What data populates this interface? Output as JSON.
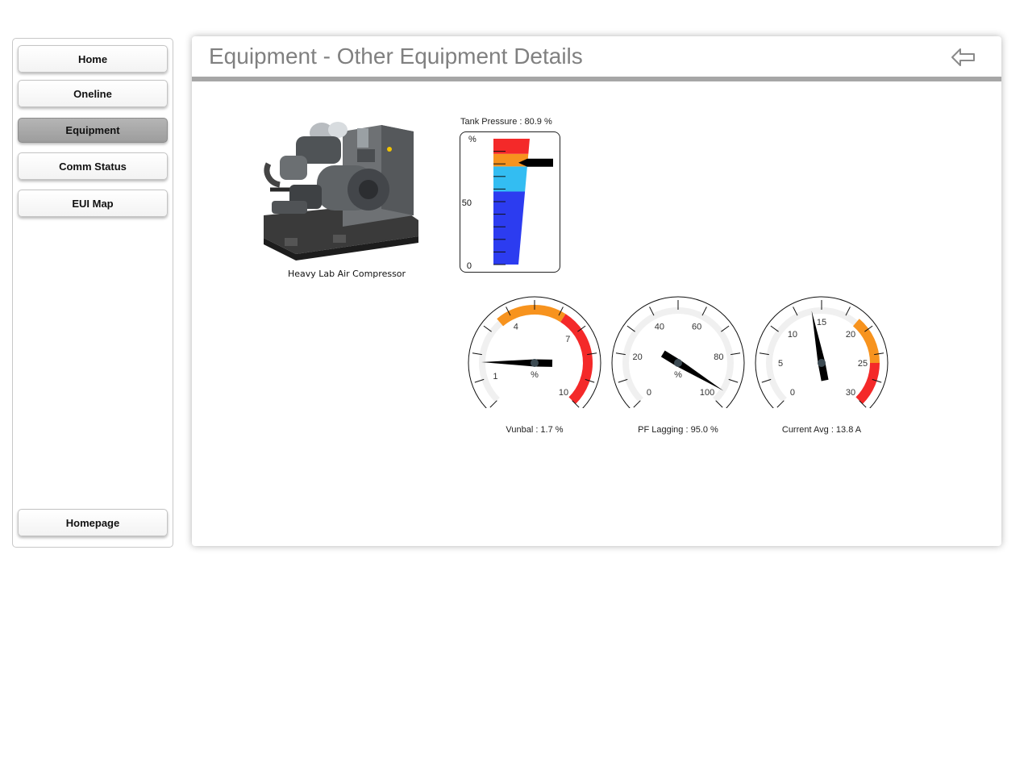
{
  "sidebar": {
    "items": [
      {
        "label": "Home"
      },
      {
        "label": "Oneline"
      },
      {
        "label": "Equipment",
        "active": true
      },
      {
        "label": "Comm Status"
      },
      {
        "label": "EUI Map"
      }
    ],
    "homepage_label": "Homepage"
  },
  "header": {
    "title": "Equipment - Other Equipment Details",
    "back_icon": "back-arrow-icon"
  },
  "equipment": {
    "caption": "Heavy Lab Air Compressor"
  },
  "colors": {
    "accent_red": "#f42929",
    "accent_orange": "#f7931e",
    "accent_cyan": "#33bdf2",
    "accent_blue": "#2c3cf0",
    "active_nav": "#a8a8a8",
    "header_rule": "#a6a6a6"
  },
  "tank": {
    "title": "Tank Pressure : 80.9 %",
    "unit": "%",
    "value": 80.9,
    "scale_labels": [
      "50",
      "0"
    ],
    "ranges": [
      {
        "from": 0,
        "to": 58,
        "color": "#2c3cf0"
      },
      {
        "from": 58,
        "to": 78,
        "color": "#33bdf2"
      },
      {
        "from": 78,
        "to": 88,
        "color": "#f7931e"
      },
      {
        "from": 88,
        "to": 100,
        "color": "#f42929"
      }
    ]
  },
  "gauges": [
    {
      "caption": "Vunbal : 1.7 %",
      "unit": "%",
      "min": 0,
      "max": 10,
      "value": 1.7,
      "labels": [
        "1",
        "4",
        "7",
        "10"
      ],
      "ranges": [
        {
          "from": 3.5,
          "to": 6.2,
          "color": "#f7931e"
        },
        {
          "from": 6.2,
          "to": 10,
          "color": "#f42929"
        }
      ]
    },
    {
      "caption": "PF Lagging : 95.0 %",
      "unit": "%",
      "min": 0,
      "max": 100,
      "value": 95.0,
      "labels": [
        "0",
        "20",
        "40",
        "60",
        "80",
        "100"
      ],
      "ranges": []
    },
    {
      "caption": "Current Avg : 13.8 A",
      "unit": "",
      "min": 0,
      "max": 30,
      "value": 13.8,
      "labels": [
        "0",
        "5",
        "10",
        "15",
        "20",
        "25",
        "30"
      ],
      "ranges": [
        {
          "from": 19.5,
          "to": 25,
          "color": "#f7931e"
        },
        {
          "from": 25,
          "to": 30,
          "color": "#f42929"
        }
      ]
    }
  ]
}
